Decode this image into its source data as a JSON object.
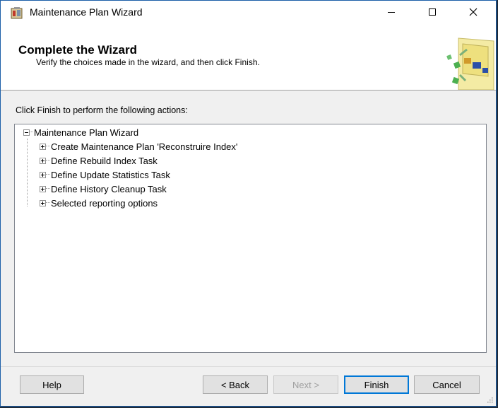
{
  "window": {
    "title": "Maintenance Plan Wizard"
  },
  "header": {
    "title": "Complete the Wizard",
    "subtitle": "Verify the choices made in the wizard, and then click Finish."
  },
  "instruction": "Click Finish to perform the following actions:",
  "tree": {
    "root": "Maintenance Plan Wizard",
    "items": [
      "Create Maintenance Plan 'Reconstruire Index'",
      "Define Rebuild Index Task",
      "Define Update Statistics Task",
      "Define History Cleanup Task",
      "Selected reporting options"
    ]
  },
  "buttons": {
    "help": "Help",
    "back": "< Back",
    "next": "Next >",
    "finish": "Finish",
    "cancel": "Cancel"
  },
  "colors": {
    "accent": "#0078d7",
    "window_border": "#1c5fa8"
  }
}
